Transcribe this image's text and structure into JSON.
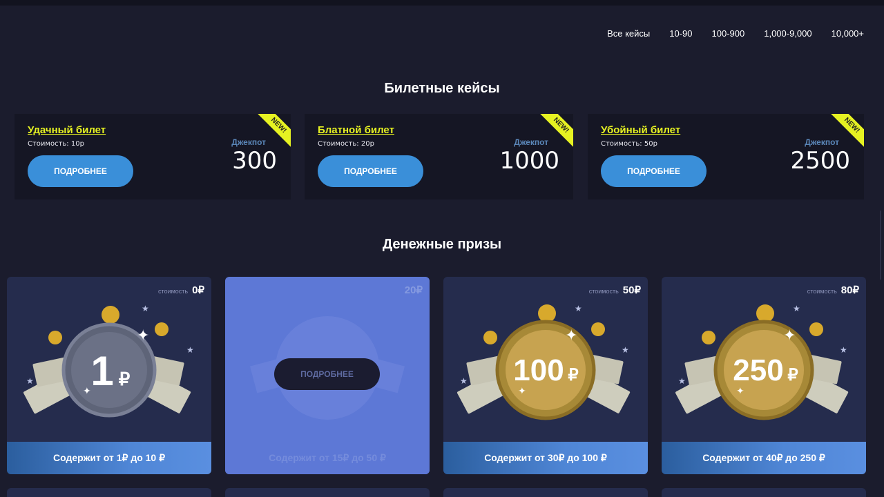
{
  "filters": [
    "Все кейсы",
    "10-90",
    "100-900",
    "1,000-9,000",
    "10,000+"
  ],
  "ticket_section_title": "Билетные кейсы",
  "tickets": [
    {
      "name": "Удачный билет",
      "cost": "Стоимость: 10р",
      "jackpot_label": "Джекпот",
      "jackpot": "300",
      "badge": "NEW!",
      "button": "ПОДРОБНЕЕ"
    },
    {
      "name": "Блатной билет",
      "cost": "Стоимость: 20р",
      "jackpot_label": "Джекпот",
      "jackpot": "1000",
      "badge": "NEW!",
      "button": "ПОДРОБНЕЕ"
    },
    {
      "name": "Убойный билет",
      "cost": "Стоимость: 50р",
      "jackpot_label": "Джекпот",
      "jackpot": "2500",
      "badge": "NEW!",
      "button": "ПОДРОБНЕЕ"
    }
  ],
  "money_section_title": "Денежные призы",
  "prizes": [
    {
      "price_label": "стоимость",
      "price": "0₽",
      "coin": "1",
      "coin_currency": "₽",
      "footer": "Содержит от 1₽ до 10 ₽"
    },
    {
      "price_label": "",
      "price": "20₽",
      "coin": "",
      "coin_currency": "",
      "footer": "Содержит от 15₽ до 50 ₽",
      "button": "ПОДРОБНЕЕ"
    },
    {
      "price_label": "стоимость",
      "price": "50₽",
      "coin": "100",
      "coin_currency": "₽",
      "footer": "Содержит от 30₽ до 100 ₽"
    },
    {
      "price_label": "стоимость",
      "price": "80₽",
      "coin": "250",
      "coin_currency": "₽",
      "footer": "Содержит от 40₽ до 250 ₽"
    }
  ],
  "colors": {
    "background": "#1b1c2d",
    "accent_yellow": "#e6f222",
    "button_blue": "#3a8fd9",
    "card": "#252c4d",
    "gold": "#c7a350",
    "silver": "#6b7186"
  }
}
